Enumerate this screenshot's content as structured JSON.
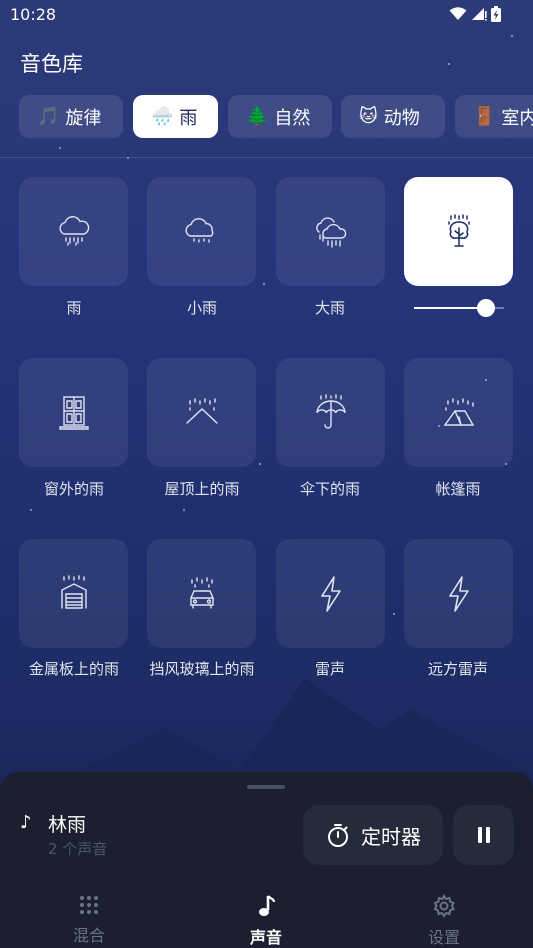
{
  "status_bar": {
    "time": "10:28"
  },
  "header": {
    "title": "音色库"
  },
  "categories": [
    {
      "emoji": "🎵",
      "label": "旋律",
      "active": false
    },
    {
      "emoji": "🌧️",
      "label": "雨",
      "active": true
    },
    {
      "emoji": "🌲",
      "label": "自然",
      "active": false
    },
    {
      "emoji": "🐱",
      "label": "动物",
      "active": false
    },
    {
      "emoji": "🚪",
      "label": "室内",
      "active": false
    }
  ],
  "sounds": [
    {
      "label": "雨",
      "icon": "cloud-rain-icon",
      "active": false
    },
    {
      "label": "小雨",
      "icon": "cloud-light-rain-icon",
      "active": false
    },
    {
      "label": "大雨",
      "icon": "cloud-heavy-rain-icon",
      "active": false
    },
    {
      "label": "",
      "icon": "tree-rain-icon",
      "active": true,
      "volume": 0.8
    },
    {
      "label": "窗外的雨",
      "icon": "window-rain-icon",
      "active": false
    },
    {
      "label": "屋顶上的雨",
      "icon": "roof-rain-icon",
      "active": false
    },
    {
      "label": "伞下的雨",
      "icon": "umbrella-rain-icon",
      "active": false
    },
    {
      "label": "帐篷雨",
      "icon": "tent-rain-icon",
      "active": false
    },
    {
      "label": "金属板上的雨",
      "icon": "garage-rain-icon",
      "active": false
    },
    {
      "label": "挡风玻璃上的雨",
      "icon": "car-rain-icon",
      "active": false
    },
    {
      "label": "雷声",
      "icon": "lightning-icon",
      "active": false
    },
    {
      "label": "远方雷声",
      "icon": "distant-lightning-icon",
      "active": false
    }
  ],
  "now_playing": {
    "title": "林雨",
    "subtitle": "2 个声音",
    "timer_label": "定时器"
  },
  "bottom_nav": [
    {
      "label": "混合",
      "icon": "grid-dots-icon",
      "active": false
    },
    {
      "label": "声音",
      "icon": "music-note-icon",
      "active": true
    },
    {
      "label": "设置",
      "icon": "gear-icon",
      "active": false
    }
  ],
  "colors": {
    "accent": "#ffffff",
    "background_top": "#2d3a78",
    "background_bottom": "#1d2a62",
    "sheet": "#1b1f2e",
    "active_icon": "#1d2a62"
  }
}
